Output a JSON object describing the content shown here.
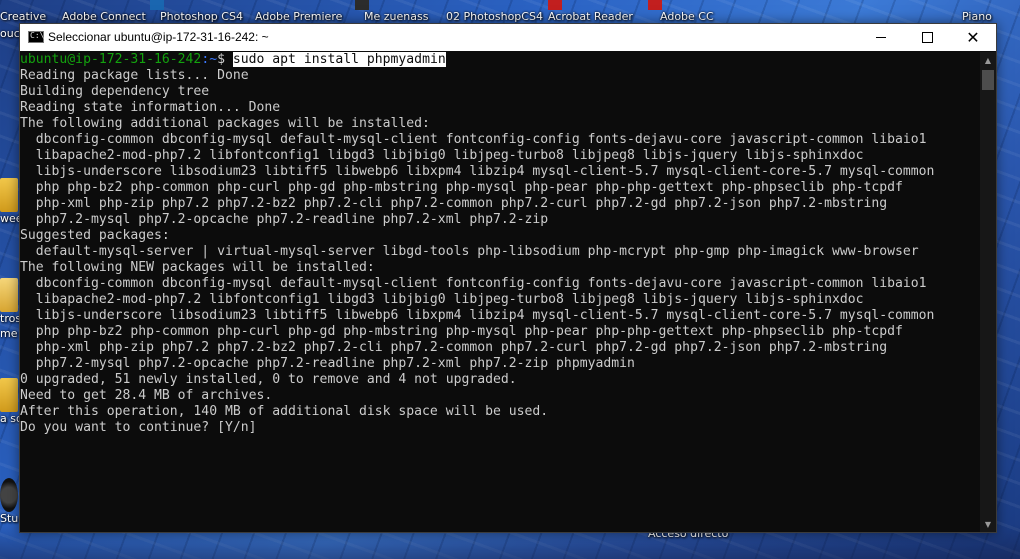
{
  "desktop": {
    "top_icons": [
      {
        "label": "Creative"
      },
      {
        "label": "Adobe Connect"
      },
      {
        "label": "Photoshop CS4"
      },
      {
        "label": "Adobe Premiere"
      },
      {
        "label": "Me zuenass"
      },
      {
        "label": "02 PhotoshopCS4"
      },
      {
        "label": "Acrobat Reader"
      },
      {
        "label": "Adobe CC"
      },
      {
        "label": "Piano"
      }
    ],
    "side_labels": [
      "ouc",
      "wee",
      "tros",
      "me",
      "a so",
      "Stu"
    ],
    "bottom_label": "Acceso directo"
  },
  "window": {
    "title": "Seleccionar ubuntu@ip-172-31-16-242: ~",
    "close_symbol": "✕"
  },
  "terminal": {
    "prompt_user": "ubuntu@ip-172-31-16-242",
    "prompt_path": ":~",
    "prompt_symbol": "$ ",
    "command": "sudo apt install phpmyadmin",
    "output": [
      "Reading package lists... Done",
      "Building dependency tree",
      "Reading state information... Done",
      "The following additional packages will be installed:",
      "  dbconfig-common dbconfig-mysql default-mysql-client fontconfig-config fonts-dejavu-core javascript-common libaio1",
      "  libapache2-mod-php7.2 libfontconfig1 libgd3 libjbig0 libjpeg-turbo8 libjpeg8 libjs-jquery libjs-sphinxdoc",
      "  libjs-underscore libsodium23 libtiff5 libwebp6 libxpm4 libzip4 mysql-client-5.7 mysql-client-core-5.7 mysql-common",
      "  php php-bz2 php-common php-curl php-gd php-mbstring php-mysql php-pear php-php-gettext php-phpseclib php-tcpdf",
      "  php-xml php-zip php7.2 php7.2-bz2 php7.2-cli php7.2-common php7.2-curl php7.2-gd php7.2-json php7.2-mbstring",
      "  php7.2-mysql php7.2-opcache php7.2-readline php7.2-xml php7.2-zip",
      "Suggested packages:",
      "  default-mysql-server | virtual-mysql-server libgd-tools php-libsodium php-mcrypt php-gmp php-imagick www-browser",
      "The following NEW packages will be installed:",
      "  dbconfig-common dbconfig-mysql default-mysql-client fontconfig-config fonts-dejavu-core javascript-common libaio1",
      "  libapache2-mod-php7.2 libfontconfig1 libgd3 libjbig0 libjpeg-turbo8 libjpeg8 libjs-jquery libjs-sphinxdoc",
      "  libjs-underscore libsodium23 libtiff5 libwebp6 libxpm4 libzip4 mysql-client-5.7 mysql-client-core-5.7 mysql-common",
      "  php php-bz2 php-common php-curl php-gd php-mbstring php-mysql php-pear php-php-gettext php-phpseclib php-tcpdf",
      "  php-xml php-zip php7.2 php7.2-bz2 php7.2-cli php7.2-common php7.2-curl php7.2-gd php7.2-json php7.2-mbstring",
      "  php7.2-mysql php7.2-opcache php7.2-readline php7.2-xml php7.2-zip phpmyadmin",
      "0 upgraded, 51 newly installed, 0 to remove and 4 not upgraded.",
      "Need to get 28.4 MB of archives.",
      "After this operation, 140 MB of additional disk space will be used.",
      "Do you want to continue? [Y/n]"
    ]
  },
  "colors": {
    "background": "#0c0c0c",
    "text": "#cccccc",
    "prompt_user": "#13a10e",
    "prompt_path": "#3b78ff"
  }
}
